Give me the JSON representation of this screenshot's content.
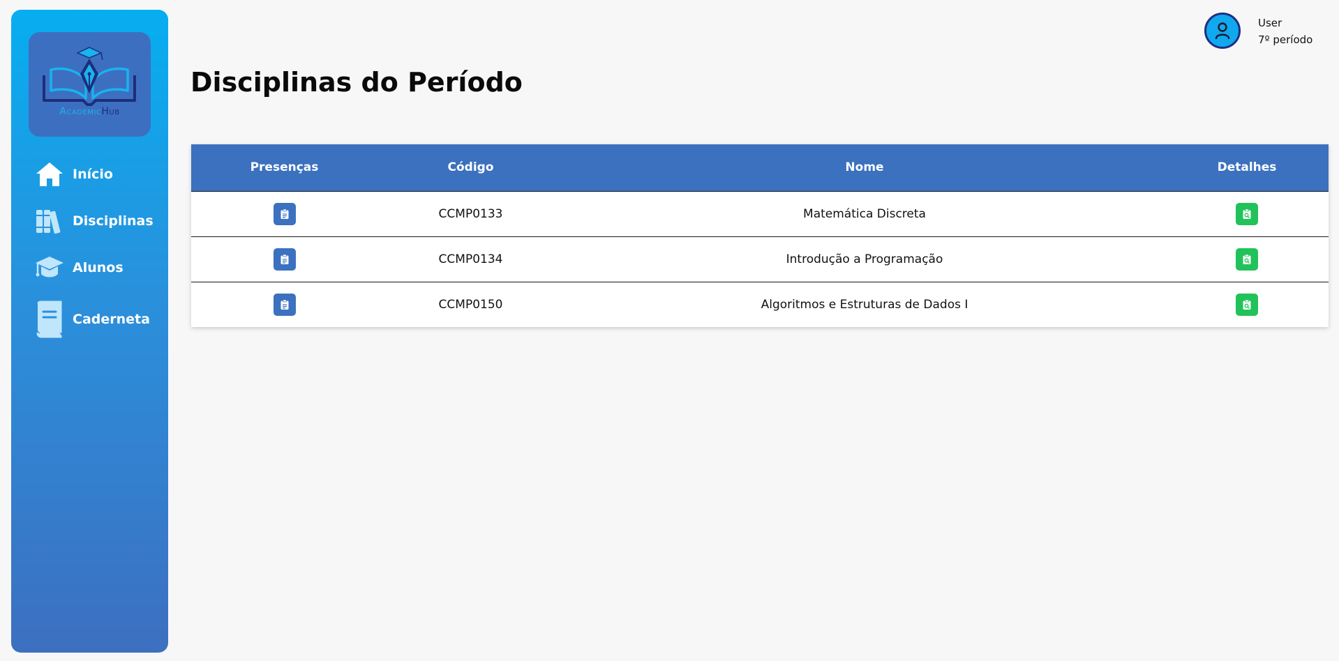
{
  "app": {
    "logo_word1": "Academic",
    "logo_word2": "Hub"
  },
  "sidebar": {
    "items": [
      {
        "label": "Início",
        "icon": "home-icon"
      },
      {
        "label": "Disciplinas",
        "icon": "books-icon"
      },
      {
        "label": "Alunos",
        "icon": "graduation-cap-icon"
      },
      {
        "label": "Caderneta",
        "icon": "notebook-icon"
      }
    ]
  },
  "user": {
    "name": "User",
    "period": "7º período",
    "icon": "user-icon"
  },
  "page": {
    "title": "Disciplinas do Período"
  },
  "table": {
    "headers": {
      "presencas": "Presenças",
      "codigo": "Código",
      "nome": "Nome",
      "detalhes": "Detalhes"
    },
    "rows": [
      {
        "codigo": "CCMP0133",
        "nome": "Matemática Discreta"
      },
      {
        "codigo": "CCMP0134",
        "nome": "Introdução a Programação"
      },
      {
        "codigo": "CCMP0150",
        "nome": "Algoritmos e Estruturas de Dados I"
      }
    ]
  },
  "colors": {
    "sidebar_top": "#06aef0",
    "sidebar_bottom": "#3d6fc0",
    "table_header": "#3b71bf",
    "presenca_button": "#3b71bf",
    "detalhe_button": "#22c25a"
  }
}
